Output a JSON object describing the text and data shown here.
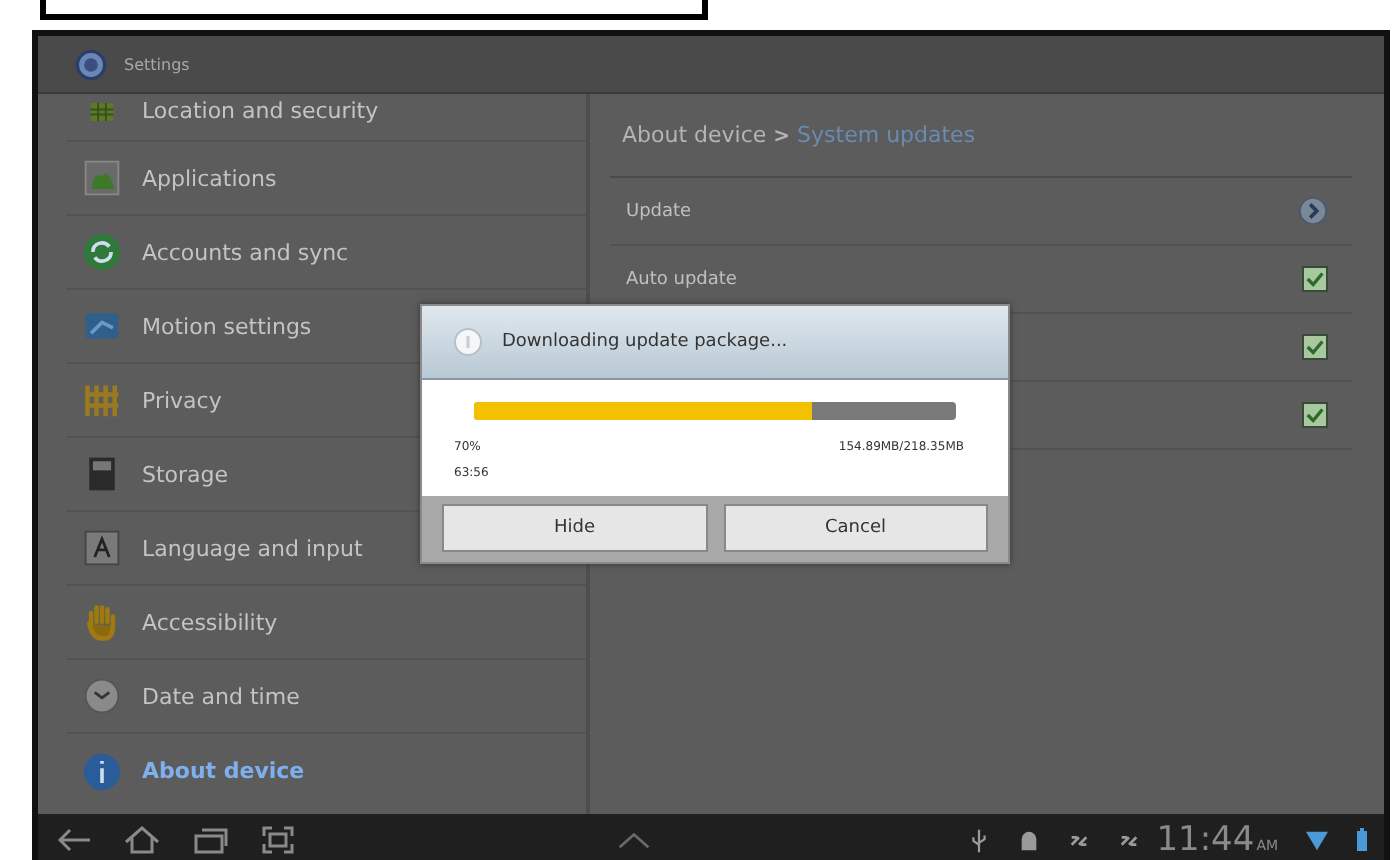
{
  "app_bar": {
    "title": "Settings"
  },
  "sidebar": {
    "items": [
      {
        "label": "Location and security",
        "selected": false
      },
      {
        "label": "Applications",
        "selected": false
      },
      {
        "label": "Accounts and sync",
        "selected": false
      },
      {
        "label": "Motion settings",
        "selected": false
      },
      {
        "label": "Privacy",
        "selected": false
      },
      {
        "label": "Storage",
        "selected": false
      },
      {
        "label": "Language and input",
        "selected": false
      },
      {
        "label": "Accessibility",
        "selected": false
      },
      {
        "label": "Date and time",
        "selected": false
      },
      {
        "label": "About device",
        "selected": true
      }
    ]
  },
  "breadcrumb": {
    "parent": "About device",
    "separator": ">",
    "current": "System updates"
  },
  "rows": [
    {
      "kind": "link",
      "label": "Update"
    },
    {
      "kind": "check",
      "label": "Auto update",
      "checked": true
    },
    {
      "kind": "check",
      "checked": true
    },
    {
      "kind": "check",
      "checked": true
    }
  ],
  "dialog": {
    "title": "Downloading update package...",
    "level": 0.7,
    "percent": "70%",
    "size": "154.89MB/218.35MB",
    "time": "63:56",
    "buttons": [
      "Hide",
      "Cancel"
    ]
  },
  "status_bar": {
    "time": "11:44",
    "ampm": "AM"
  }
}
